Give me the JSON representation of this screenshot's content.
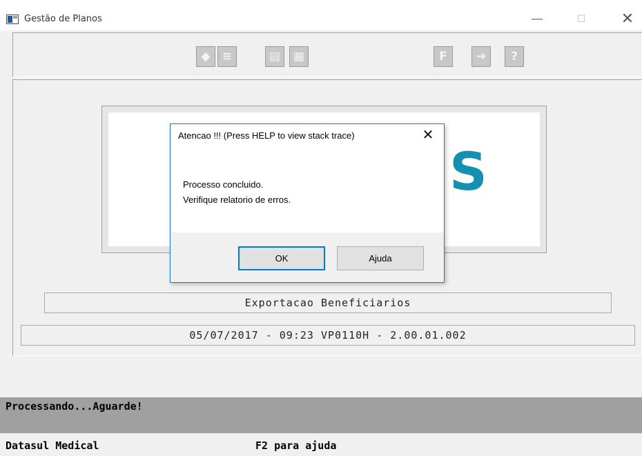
{
  "window": {
    "title": "Gestão de Planos",
    "minimize_glyph": "—",
    "maximize_glyph": "☐",
    "close_glyph": "✕"
  },
  "toolbar": {
    "left_buttons": [
      {
        "icon": "tag-icon",
        "glyph": "◆"
      },
      {
        "icon": "list-icon",
        "glyph": "≡"
      },
      {
        "icon": "document-icon",
        "glyph": "▤"
      },
      {
        "icon": "grid-settings-icon",
        "glyph": "▦"
      }
    ],
    "right_buttons": [
      {
        "icon": "function-icon",
        "glyph": "F"
      },
      {
        "icon": "exit-door-icon",
        "glyph": "➜"
      },
      {
        "icon": "help-icon",
        "glyph": "?"
      }
    ]
  },
  "logo": {
    "visible_letter": "S",
    "color": "#1590b0"
  },
  "program_name": "Exportacao Beneficiarios",
  "version_line": "05/07/2017 - 09:23  VP0110H - 2.00.01.002",
  "status_message": "Processando...Aguarde!",
  "footer": {
    "app_name": "Datasul Medical",
    "help_hint": "F2 para ajuda"
  },
  "dialog": {
    "title": "Atencao !!! (Press HELP to view stack trace)",
    "close_glyph": "✕",
    "message_lines": [
      "Processo concluido.",
      "Verifique relatorio de erros."
    ],
    "ok_label": "OK",
    "help_label": "Ajuda",
    "accent_color": "#0078d7"
  }
}
